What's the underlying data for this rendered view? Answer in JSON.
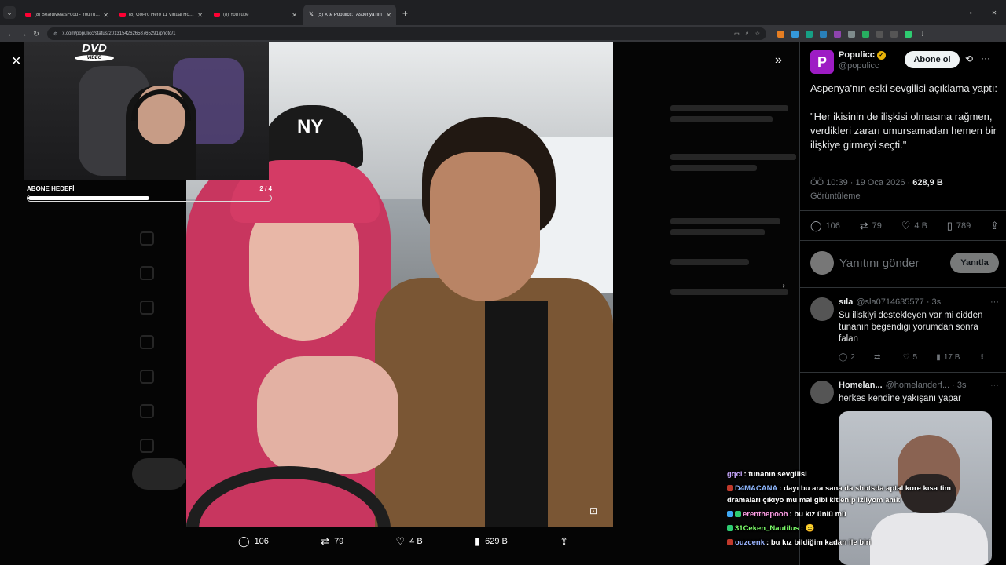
{
  "browser": {
    "tabs": [
      {
        "title": "(8) BeardMeatsFood - YouTube",
        "active": false,
        "favicon": "youtube-icon"
      },
      {
        "title": "(8) GoPro Hero 11 Virtual Horse",
        "active": false,
        "favicon": "youtube-icon"
      },
      {
        "title": "(8) YouTube",
        "active": false,
        "favicon": "youtube-icon"
      },
      {
        "title": "(5) X'te Populicc: \"Aspenya'nın",
        "active": true,
        "favicon": "x-icon"
      }
    ],
    "url": "x.com/populicc/status/2013154262658765291/photo/1"
  },
  "viewer": {
    "actions": {
      "replies": "106",
      "reposts": "79",
      "likes": "4 B",
      "views": "629 B"
    }
  },
  "stream": {
    "dvd_top": "DVD",
    "dvd_bottom": "VIDEO",
    "goal_label": "ABONE HEDEFİ",
    "goal_count": "2 / 4",
    "goal_progress": 0.5
  },
  "tweet": {
    "display_name": "Populicc",
    "avatar_letter": "P",
    "username": "@populicc",
    "follow_label": "Abone ol",
    "text": "Aspenya'nın eski sevgilisi açıklama yaptı:\n\n\"Her ikisinin de ilişkisi olmasına rağmen, verdikleri zararı umursamadan hemen bir ilişkiye girmeyi seçti.\"",
    "time": "ÖÖ 10:39 · 19 Oca 2026 · ",
    "views": "628,9 B",
    "views_label": "Görüntüleme",
    "stats": {
      "replies": "106",
      "reposts": "79",
      "likes": "4 B",
      "bookmarks": "789"
    },
    "reply_placeholder": "Yanıtını gönder",
    "reply_button": "Yanıtla"
  },
  "replies": [
    {
      "name": "sıla",
      "handle": "@sla0714635577 · 3s",
      "text": "Su iliskiyi destekleyen var mi cidden tunanın begendigi yorumdan sonra falan",
      "replies": "2",
      "reposts": "",
      "likes": "5",
      "views": "17 B"
    },
    {
      "name": "Homelan...",
      "handle": "@homelanderf... · 3s",
      "text": "herkes kendine yakışanı yapar"
    }
  ],
  "chat": [
    {
      "user": "gqci",
      "color": "#c9a9ff",
      "text": ": tunanın sevgilisi",
      "badges": []
    },
    {
      "user": "D4MACANA",
      "color": "#8fb8ff",
      "text": ": dayı bu ara sana da shotsda aptal kore kısa fim dramaları çıkıyo mu mal gibi kitlenip izliyom amk",
      "badges": [
        "#c0392b"
      ]
    },
    {
      "user": "erenthepooh",
      "color": "#ff9ee6",
      "text": ": bu kız ünlü mü",
      "badges": [
        "#3fa9f5",
        "#2ecc71"
      ]
    },
    {
      "user": "31Ceken_Nautilus",
      "color": "#7dff6a",
      "text": ": 😐",
      "badges": [
        "#2ecc71"
      ]
    },
    {
      "user": "ouzcenk",
      "color": "#9bb5ff",
      "text": ": bu kız bildiğim kadarı ile biri",
      "badges": [
        "#c0392b"
      ]
    }
  ]
}
